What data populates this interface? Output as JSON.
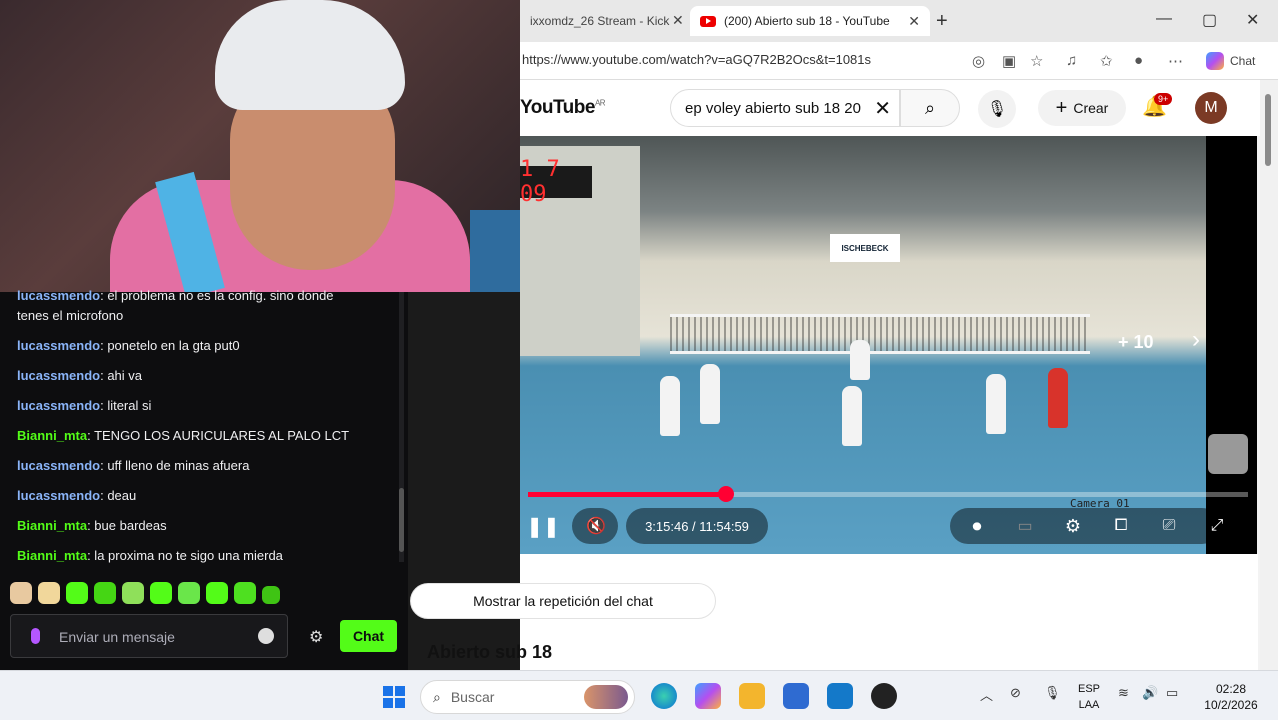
{
  "browser": {
    "tabs": [
      {
        "label": "ixxomdz_26 Stream - Kick"
      },
      {
        "label": "(200) Abierto sub 18 - YouTube"
      }
    ],
    "url": "https://www.youtube.com/watch?v=aGQ7R2B2Ocs&t=1081s",
    "copilot_label": "Chat"
  },
  "youtube": {
    "logo": "YouTube",
    "region": "AR",
    "search_value": "ep voley abierto sub 18 20",
    "create_label": "Crear",
    "notif_badge": "9+",
    "avatar_letter": "M",
    "video": {
      "scoreboard": "1 7 09",
      "banner": "ISCHEBECK",
      "camera_label": "Camera 01",
      "plus_label": "+ 10",
      "current_time": "3:15:46",
      "duration": "11:54:59",
      "time_display": "3:15:46 / 11:54:59",
      "progress": 0.275
    },
    "show_chat_label": "Mostrar la repetición del chat",
    "video_title": "Abierto sub 18"
  },
  "chat": {
    "messages": [
      {
        "user": "lucassmendo",
        "color": "blue",
        "text": ": el problema no es la config. sino donde",
        "cont": "tenes el microfono"
      },
      {
        "user": "lucassmendo",
        "color": "blue",
        "text": ": ponetelo en la gta put0"
      },
      {
        "user": "lucassmendo",
        "color": "blue",
        "text": ": ahi va"
      },
      {
        "user": "lucassmendo",
        "color": "blue",
        "text": ": literal si"
      },
      {
        "user": "Bianni_mta",
        "color": "green",
        "text": ": TENGO LOS AURICULARES AL PALO LCT"
      },
      {
        "user": "lucassmendo",
        "color": "blue",
        "text": ": uff lleno de minas afuera"
      },
      {
        "user": "lucassmendo",
        "color": "blue",
        "text": ": deau"
      },
      {
        "user": "Bianni_mta",
        "color": "green",
        "text": ": bue bardeas"
      },
      {
        "user": "Bianni_mta",
        "color": "green",
        "text": ": la proxima no te sigo una mierda"
      }
    ],
    "input_placeholder": "Enviar un mensaje",
    "send_label": "Chat"
  },
  "taskbar": {
    "search_placeholder": "Buscar",
    "lang_line1": "ESP",
    "lang_line2": "LAA",
    "time": "02:28",
    "date": "10/2/2026"
  },
  "colors": {
    "kick_green": "#53fc18",
    "yt_red": "#ff0033",
    "user_blue": "#8ab4f8"
  }
}
